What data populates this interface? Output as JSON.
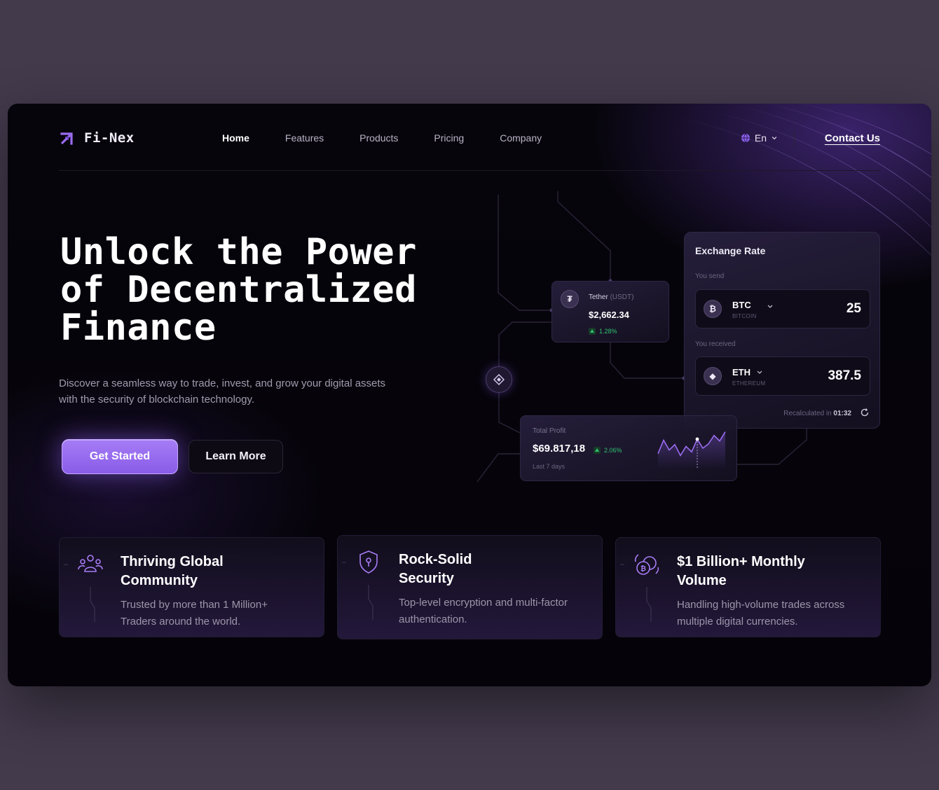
{
  "brand": {
    "name": "Fi-Nex",
    "icon": "arrow-up-right-icon",
    "accent": "#9b6cf2"
  },
  "nav": [
    {
      "label": "Home",
      "active": true
    },
    {
      "label": "Features",
      "active": false
    },
    {
      "label": "Products",
      "active": false
    },
    {
      "label": "Pricing",
      "active": false
    },
    {
      "label": "Company",
      "active": false
    }
  ],
  "language": {
    "label": "En",
    "icon": "globe-icon"
  },
  "contact": "Contact Us",
  "hero": {
    "title_lines": [
      "Unlock the Power",
      "of Decentralized",
      "Finance"
    ],
    "subtitle": "Discover a seamless way to trade, invest, and grow your digital assets with the security of blockchain technology.",
    "primary_button": "Get Started",
    "secondary_button": "Learn More"
  },
  "tether_card": {
    "name": "Tether",
    "ticker": "(USDT)",
    "price": "$2,662.34",
    "change": "1.28%"
  },
  "exchange": {
    "title": "Exchange Rate",
    "send_label": "You send",
    "send": {
      "symbol": "BTC",
      "full": "BITCOIN",
      "amount": "25"
    },
    "receive_label": "You received",
    "receive": {
      "symbol": "ETH",
      "full": "ETHEREUM",
      "amount": "387.5"
    },
    "recalc_prefix": "Recalculated in",
    "recalc_time": "01:32"
  },
  "profit": {
    "label": "Total Profit",
    "value": "$69.817,18",
    "change": "2.06%",
    "period": "Last 7 days",
    "sparkline": [
      0.35,
      0.72,
      0.45,
      0.6,
      0.3,
      0.55,
      0.4,
      0.75,
      0.5,
      0.62,
      0.85,
      0.7,
      0.95
    ]
  },
  "features": [
    {
      "icon": "users-icon",
      "title": "Thriving Global Community",
      "description": "Trusted by more than 1 Million+ Traders around the world."
    },
    {
      "icon": "shield-lock-icon",
      "title": "Rock-Solid Security",
      "description": "Top-level encryption and multi-factor authentication."
    },
    {
      "icon": "coins-exchange-icon",
      "title": "$1 Billion+ Monthly Volume",
      "description": "Handling high-volume trades across multiple digital currencies."
    }
  ]
}
